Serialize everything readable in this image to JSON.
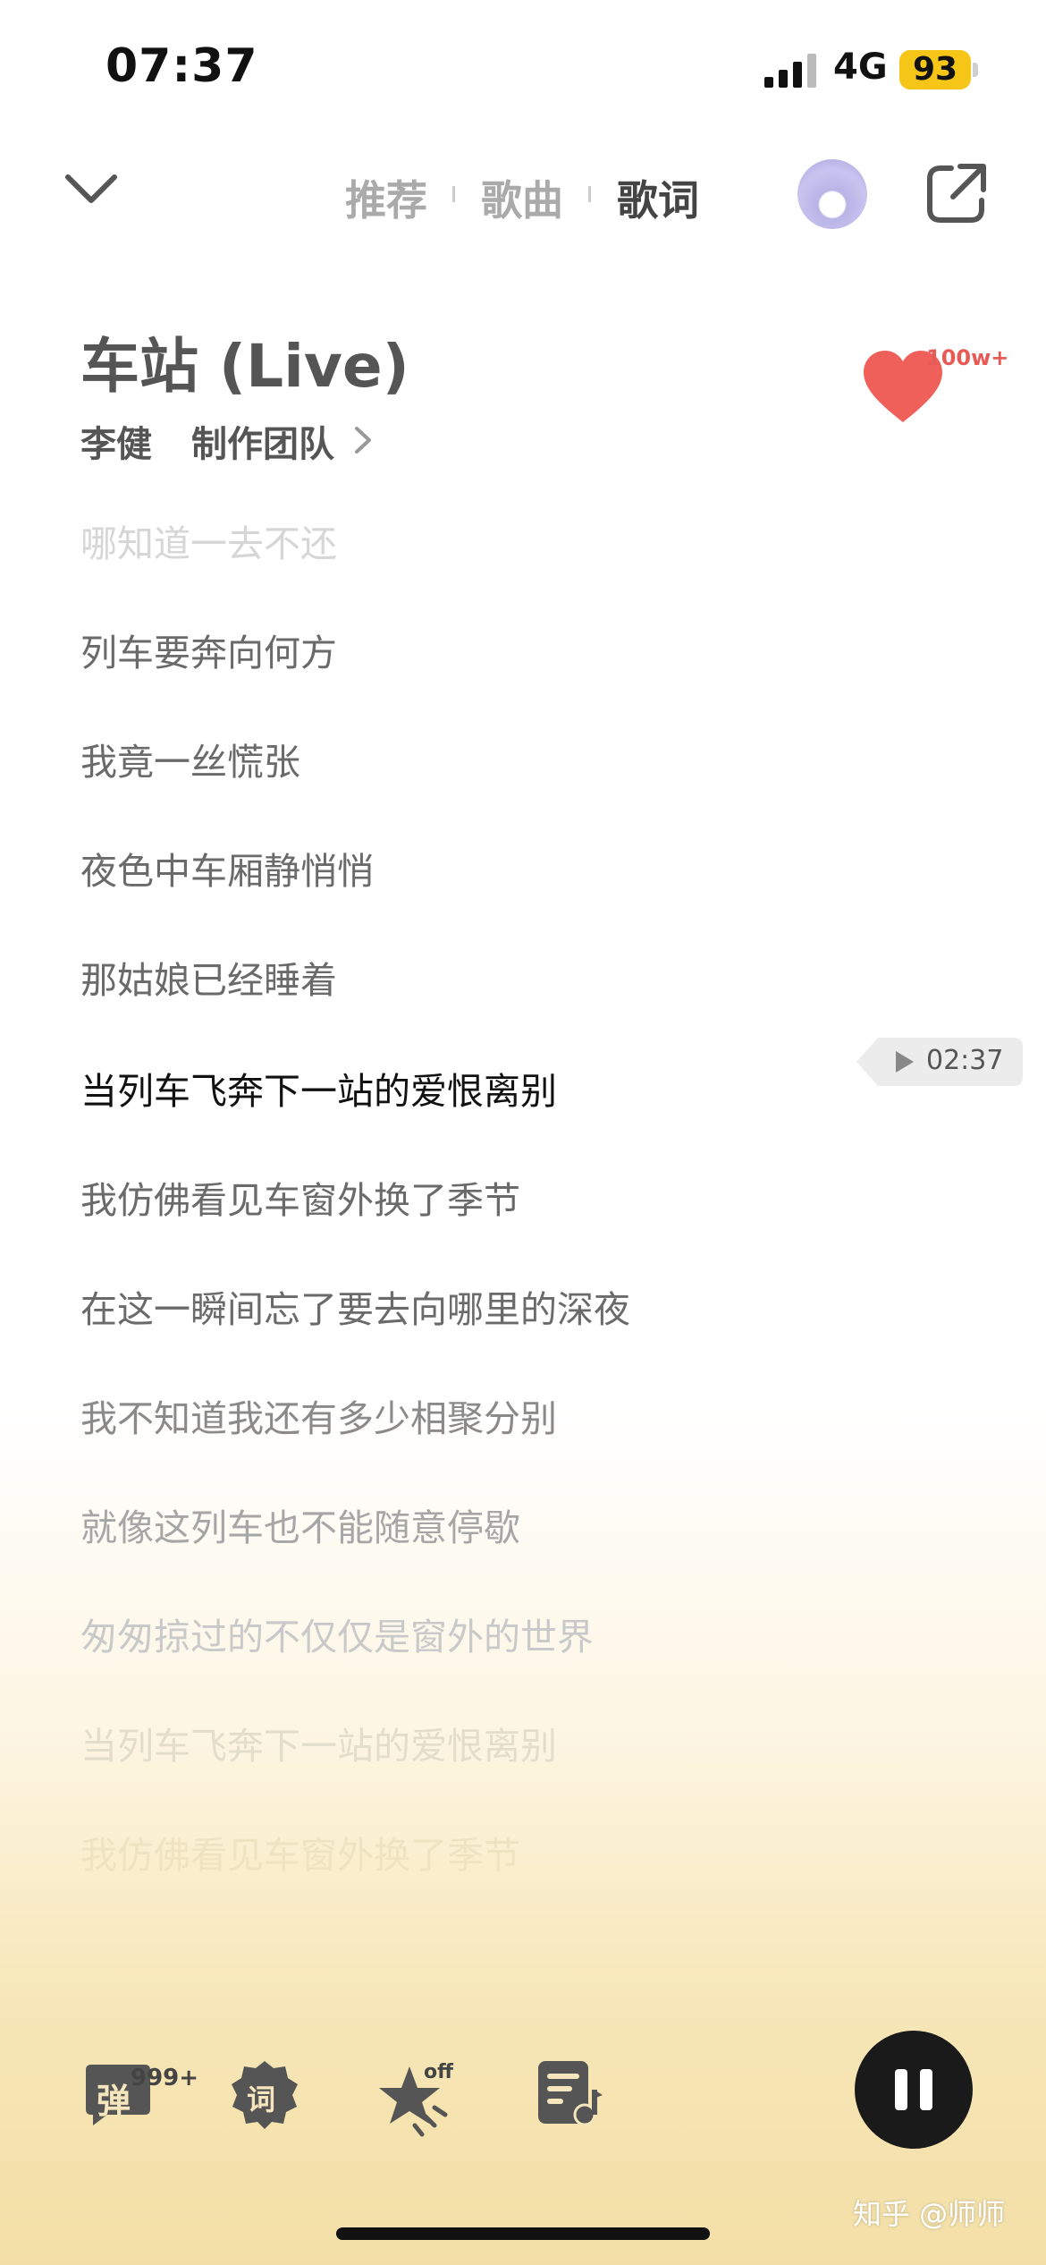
{
  "status_bar": {
    "time": "07:37",
    "network": "4G",
    "battery": "93"
  },
  "nav": {
    "tabs": [
      {
        "label": "推荐",
        "active": false
      },
      {
        "label": "歌曲",
        "active": false
      },
      {
        "label": "歌词",
        "active": true
      }
    ]
  },
  "song": {
    "title": "车站 (Live)",
    "artist": "李健",
    "credits_label": "制作团队",
    "like_count": "100w+"
  },
  "lyrics": {
    "lines": [
      {
        "text": "哪知道一去不还",
        "state": "faded-top"
      },
      {
        "text": "列车要奔向何方",
        "state": "past"
      },
      {
        "text": "我竟一丝慌张",
        "state": "past"
      },
      {
        "text": "夜色中车厢静悄悄",
        "state": "past"
      },
      {
        "text": "那姑娘已经睡着",
        "state": "past"
      },
      {
        "text": "当列车飞奔下一站的爱恨离别",
        "state": "current"
      },
      {
        "text": "我仿佛看见车窗外换了季节",
        "state": "upcoming"
      },
      {
        "text": "在这一瞬间忘了要去向哪里的深夜",
        "state": "upcoming"
      },
      {
        "text": "我不知道我还有多少相聚分别",
        "state": "upcoming"
      },
      {
        "text": "就像这列车也不能随意停歇",
        "state": "upcoming"
      },
      {
        "text": "匆匆掠过的不仅仅是窗外的世界",
        "state": "faded"
      },
      {
        "text": "当列车飞奔下一站的爱恨离别",
        "state": "faded"
      },
      {
        "text": "我仿佛看见车窗外换了季节",
        "state": "faded-bottom"
      }
    ],
    "current_time": "02:37"
  },
  "toolbar": {
    "danmaku_label": "弹",
    "danmaku_count": "999+",
    "lyric_effect_label": "词",
    "star_badge": "off"
  },
  "watermark": "知乎 @师师",
  "colors": {
    "heart": "#f0605a",
    "battery": "#f5c518",
    "pause_button": "#1a1a1a",
    "gradient_bottom": "#f3dfa6"
  }
}
